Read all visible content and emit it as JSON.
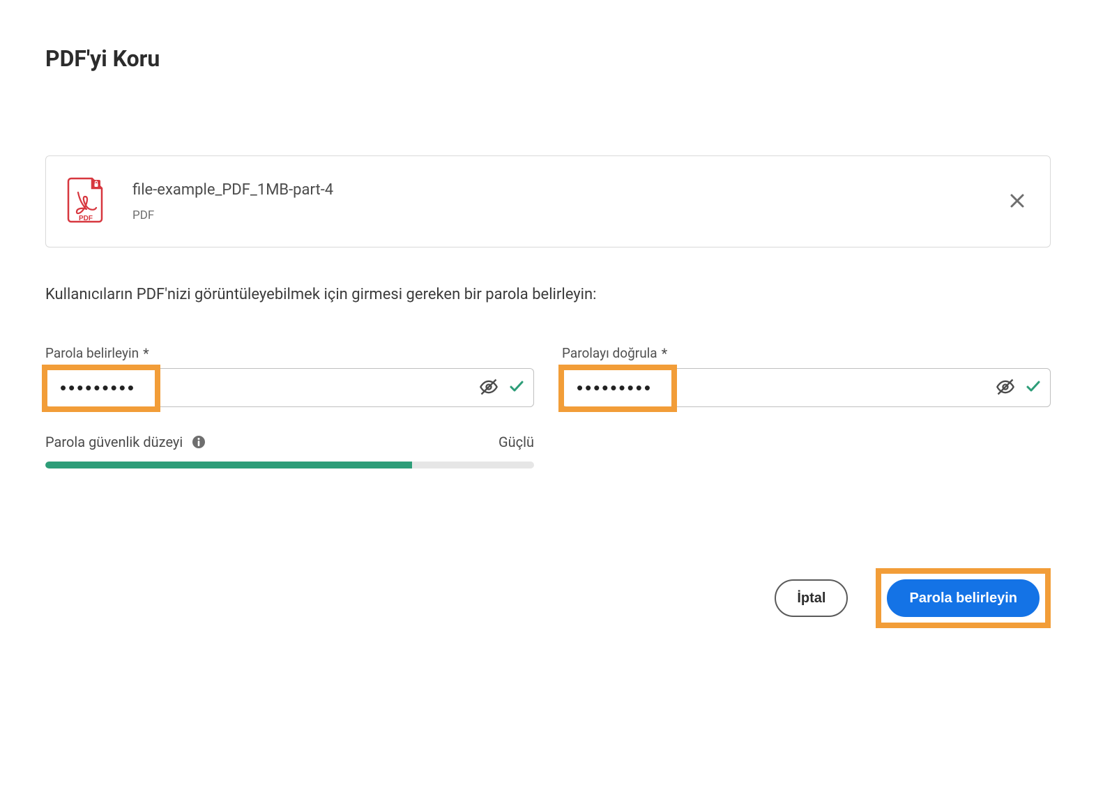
{
  "header": {
    "title": "PDF'yi Koru"
  },
  "file": {
    "name": "file-example_PDF_1MB-part-4",
    "type": "PDF",
    "icon_badge": "PDF"
  },
  "instruction": "Kullanıcıların PDF'nizi görüntüleyebilmek için girmesi gereken bir parola belirleyin:",
  "fields": {
    "set_password": {
      "label": "Parola belirleyin",
      "required_mark": "*",
      "value": "•••••••••"
    },
    "confirm_password": {
      "label": "Parolayı doğrula",
      "required_mark": "*",
      "value": "•••••••••"
    }
  },
  "strength": {
    "label": "Parola güvenlik düzeyi",
    "level_text": "Güçlü",
    "percent": 75
  },
  "buttons": {
    "cancel": "İptal",
    "submit": "Parola belirleyin"
  },
  "colors": {
    "accent": "#1473e6",
    "strength_fill": "#2d9d78",
    "highlight": "#f29d38"
  }
}
